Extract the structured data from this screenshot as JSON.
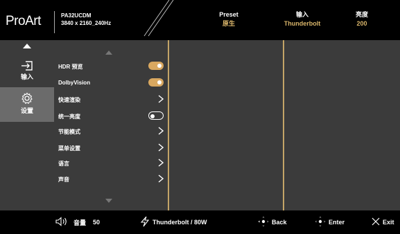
{
  "header": {
    "logo": "ProArt",
    "model_name": "PA32UCDM",
    "model_mode": "3840 x 2160_240Hz",
    "preset_label": "Preset",
    "preset_value": "原生",
    "input_label": "输入",
    "input_value": "Thunderbolt",
    "brightness_label": "亮度",
    "brightness_value": "200",
    "accent_color": "#d9b56a"
  },
  "sidebar": {
    "items": [
      {
        "label": "输入",
        "icon": "input-icon"
      },
      {
        "label": "设置",
        "icon": "gear-icon"
      }
    ]
  },
  "menu": {
    "items": [
      {
        "label": "HDR 预览",
        "control": "toggle-on"
      },
      {
        "label": "DolbyVision",
        "control": "toggle-on"
      },
      {
        "label": "快速渲染",
        "control": "chevron"
      },
      {
        "label": "统一亮度",
        "control": "toggle-off"
      },
      {
        "label": "节能模式",
        "control": "chevron"
      },
      {
        "label": "菜单设置",
        "control": "chevron"
      },
      {
        "label": "语言",
        "control": "chevron"
      },
      {
        "label": "声音",
        "control": "chevron"
      }
    ]
  },
  "footer": {
    "volume_label": "音量",
    "volume_value": "50",
    "power_source": "Thunderbolt / 80W",
    "back_label": "Back",
    "enter_label": "Enter",
    "exit_label": "Exit"
  },
  "colors": {
    "panel_bg": "#3b3b3b",
    "active_bg": "#6b6b6b",
    "separator": "#c4a567",
    "toggle_on": "#d9a860"
  }
}
